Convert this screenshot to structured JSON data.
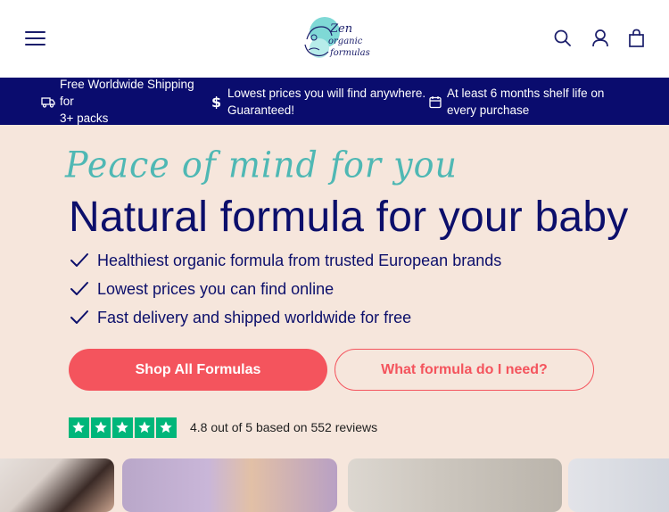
{
  "header": {
    "logo_lines": [
      "Zen",
      "organic",
      "formulas"
    ]
  },
  "announcement": [
    {
      "icon": "truck-icon",
      "text_line1": "Free Worldwide Shipping for",
      "text_line2": "3+ packs"
    },
    {
      "icon": "dollar-icon",
      "text_line1": "Lowest prices you will find anywhere.",
      "text_line2": "Guaranteed!"
    },
    {
      "icon": "calendar-icon",
      "text_line1": "At least 6 months shelf life on",
      "text_line2": "every purchase"
    }
  ],
  "hero": {
    "script_title": "Peace of mind for you",
    "headline": "Natural formula for your baby",
    "features": [
      "Healthiest organic formula from trusted European brands",
      "Lowest prices you can find online",
      "Fast delivery and shipped worldwide for free"
    ],
    "primary_cta": "Shop All Formulas",
    "secondary_cta": "What formula do I need?"
  },
  "rating": {
    "stars": 5,
    "text": "4.8 out of 5 based on 552 reviews"
  },
  "colors": {
    "navy": "#0a0c6e",
    "coral": "#f4545d",
    "teal": "#4fb8b4",
    "background": "#f6e6dc",
    "trustpilot_green": "#00b67a"
  }
}
